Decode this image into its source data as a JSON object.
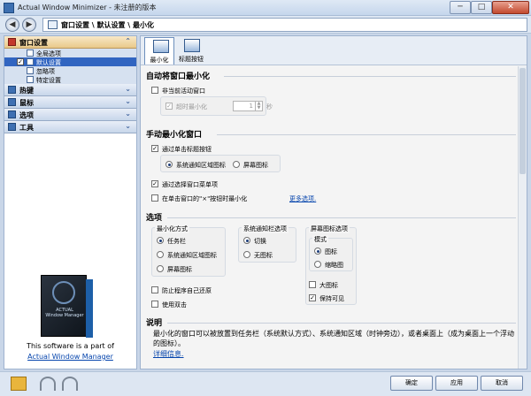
{
  "window": {
    "title": "Actual Window Minimizer - 未注册的版本",
    "min": "─",
    "max": "□",
    "close": "✕"
  },
  "nav": {
    "back": "◀",
    "forward": "▶",
    "breadcrumb": "窗口设置 \\ 默认设置 \\ 最小化"
  },
  "sidebar": {
    "groups": [
      {
        "label": "窗口设置",
        "chevron": "⌃"
      },
      {
        "label": "热键",
        "chevron": "⌄"
      },
      {
        "label": "鼠标",
        "chevron": "⌄"
      },
      {
        "label": "选项",
        "chevron": "⌄"
      },
      {
        "label": "工具",
        "chevron": "⌄"
      }
    ],
    "items": [
      {
        "label": "全局选项"
      },
      {
        "label": "默认设置",
        "checked": "✓"
      },
      {
        "label": "忽略项"
      },
      {
        "label": "特定设置"
      }
    ],
    "promo": {
      "box_top": "ACTUAL",
      "box_name": "Window Manager",
      "text": "This software is a part of",
      "link": "Actual Window Manager"
    }
  },
  "tabs": [
    {
      "label": "最小化"
    },
    {
      "label": "标题按钮"
    }
  ],
  "auto": {
    "title": "自动将窗口最小化",
    "inactive": {
      "label": "非当前活动窗口",
      "checked": false
    },
    "timeout": {
      "label": "超时最小化",
      "value": "1",
      "unit": "秒",
      "checked": "✓"
    }
  },
  "manual": {
    "title": "手动最小化窗口",
    "via_title_button": {
      "label": "通过单击标题按钮",
      "checked": "✓"
    },
    "opt_tray": {
      "label": "系统通知区域图标",
      "selected": true
    },
    "opt_screen": {
      "label": "屏幕图标",
      "selected": false
    },
    "via_menu": {
      "label": "通过选择窗口菜单项",
      "checked": "✓"
    },
    "via_close": {
      "label": "在单击窗口的\"×\"按钮时最小化"
    },
    "more_link": "更多选项."
  },
  "options": {
    "title": "选项",
    "min_method": {
      "title": "最小化方式",
      "items": [
        {
          "label": "任务栏",
          "selected": true
        },
        {
          "label": "系统通知区域图标",
          "selected": false
        },
        {
          "label": "屏幕图标",
          "selected": false
        }
      ]
    },
    "tray_opts": {
      "title": "系统通知栏选项",
      "items": [
        {
          "label": "切换",
          "selected": true
        },
        {
          "label": "无图标",
          "selected": false
        }
      ]
    },
    "screen_opts": {
      "title": "屏幕图标选项",
      "mode": "模式",
      "items": [
        {
          "label": "图标",
          "selected": true
        },
        {
          "label": "缩略图",
          "selected": false
        }
      ],
      "big_icon": {
        "label": "大图标"
      },
      "keep_visible": {
        "label": "保持可见",
        "checked": "✓"
      }
    },
    "prevent_restore": {
      "label": "防止程序自己还原"
    },
    "double_click": {
      "label": "使用双击"
    }
  },
  "description": {
    "title": "说明",
    "text": "最小化的窗口可以被放置到任务栏（系统默认方式）、系统通知区域（时钟旁边），或者桌面上（成为桌面上一个浮动的图标）。",
    "more": "详细信息."
  },
  "footer": {
    "ok": "确定",
    "apply": "应用",
    "cancel": "取消"
  }
}
